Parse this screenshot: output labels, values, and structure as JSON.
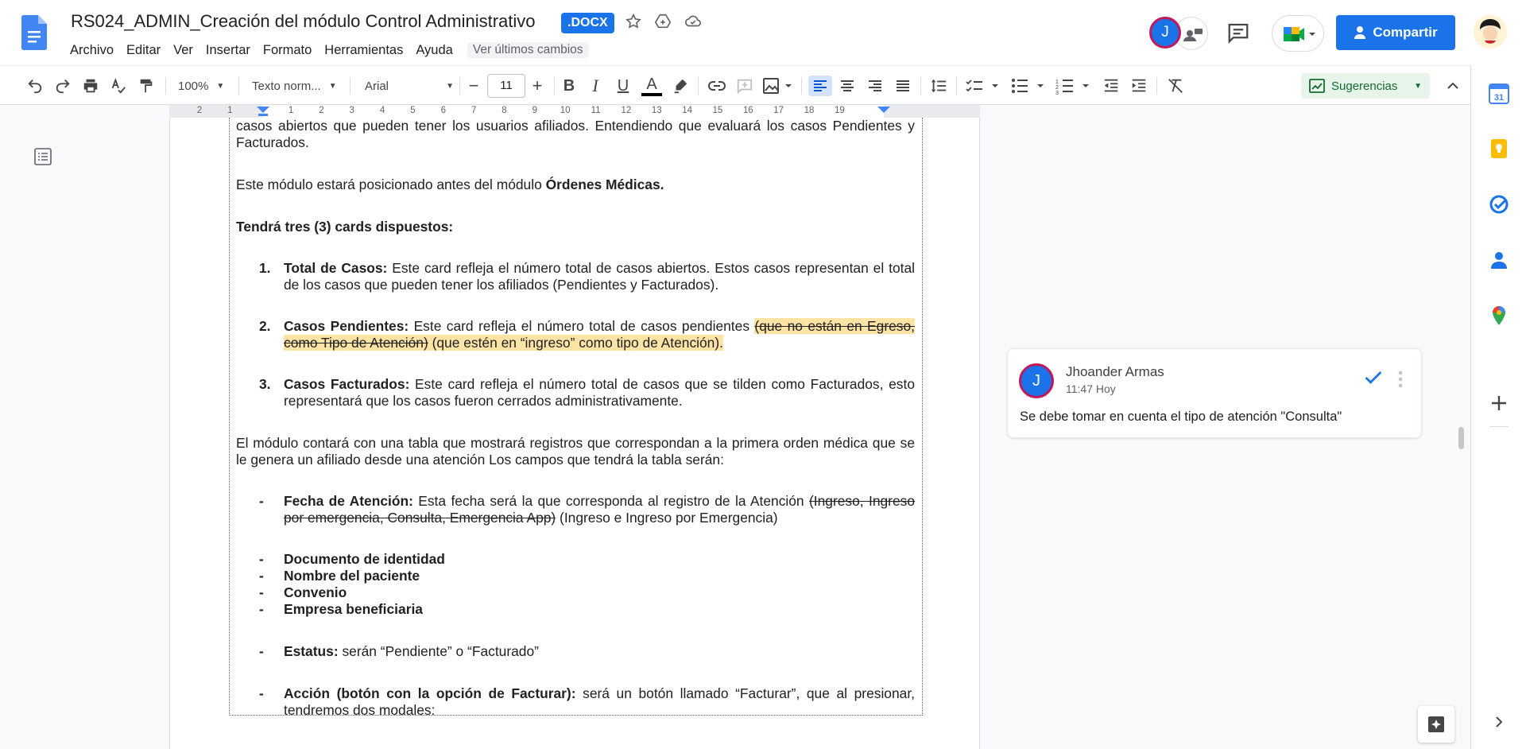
{
  "document": {
    "title": "RS024_ADMIN_Creación del módulo Control Administrativo",
    "format_badge": ".DOCX"
  },
  "menu": [
    "Archivo",
    "Editar",
    "Ver",
    "Insertar",
    "Formato",
    "Herramientas",
    "Ayuda"
  ],
  "last_edit": "Ver últimos cambios",
  "collaborator_initial": "J",
  "share_label": "Compartir",
  "toolbar": {
    "zoom": "100%",
    "style": "Texto norm...",
    "font": "Arial",
    "font_size": "11",
    "bold": "B",
    "italic": "I",
    "underline": "U",
    "text_color": "A",
    "mode": "Sugerencias"
  },
  "ruler_labels": [
    "2",
    "1",
    "",
    "1",
    "2",
    "3",
    "4",
    "5",
    "6",
    "7",
    "8",
    "9",
    "10",
    "11",
    "12",
    "13",
    "14",
    "15",
    "16",
    "17",
    "18",
    "19"
  ],
  "body": {
    "p0": "casos abiertos que pueden tener los usuarios afiliados. Entendiendo que evaluará los casos Pendientes y Facturados.",
    "p1_text": "Este módulo estará posicionado antes del módulo ",
    "p1_bold": "Órdenes Médicas.",
    "p2_bold": "Tendrá tres (3) cards dispuestos:",
    "item1": {
      "marker": "1.",
      "bold": "Total de Casos:",
      "text": " Este card refleja el número total de casos abiertos. Estos casos representan el total de los casos que pueden tener los afiliados (Pendientes y Facturados)."
    },
    "item2": {
      "marker": "2.",
      "bold": "Casos Pendientes:",
      "text": " Este card refleja el número total de casos pendientes ",
      "deleted": "(que no están en Egreso, como Tipo de Atención)",
      "inserted": " (que estén en “ingreso” como tipo de Atención)."
    },
    "item3": {
      "marker": "3.",
      "bold": "Casos Facturados:",
      "text": " Este card refleja el número total de casos que se tilden como Facturados, esto representará que los casos fueron cerrados administrativamente."
    },
    "p3": "El módulo contará con una tabla que mostrará registros que correspondan a la primera orden médica que se le genera un afiliado desde una atención Los campos que tendrá la  tabla serán:",
    "field1": {
      "marker": "-",
      "bold": "Fecha de Atención:",
      "text": " Esta fecha será la que corresponda al registro de la Atención ",
      "deleted": "(Ingreso, Ingreso por emergencia, Consulta, Emergencia App)",
      "inserted": " (Ingreso e Ingreso por Emergencia)"
    },
    "field2": {
      "marker": "-",
      "bold": "Documento de identidad"
    },
    "field3": {
      "marker": "-",
      "bold": "Nombre del paciente"
    },
    "field4": {
      "marker": "-",
      "bold": "Convenio"
    },
    "field5": {
      "marker": "-",
      "bold": "Empresa beneficiaria"
    },
    "field6": {
      "marker": "-",
      "bold": "Estatus:",
      "text": " serán “Pendiente” o “Facturado”"
    },
    "field7": {
      "marker": "-",
      "bold": "Acción (botón con la opción de Facturar):",
      "text": " será un botón llamado “Facturar”, que al presionar, tendremos dos modales:"
    }
  },
  "comment": {
    "initial": "J",
    "author": "Jhoander Armas",
    "time": "11:47 Hoy",
    "text": "Se debe tomar en cuenta el tipo de atención \"Consulta\""
  },
  "colors": {
    "brand": "#1a73e8",
    "suggestion_highlight": "#fde4a5",
    "suggestion_mode": "#146c2e"
  },
  "icons": [
    "undo-icon",
    "redo-icon",
    "print-icon",
    "spellcheck-icon",
    "paint-format-icon",
    "highlighter-icon",
    "link-icon",
    "add-comment-icon",
    "image-icon",
    "align-left-icon",
    "align-center-icon",
    "align-right-icon",
    "justify-icon",
    "line-spacing-icon",
    "checklist-icon",
    "bullet-list-icon",
    "numbered-list-icon",
    "decrease-indent-icon",
    "increase-indent-icon",
    "clear-format-icon",
    "outline-icon",
    "calendar-icon",
    "keep-icon",
    "tasks-icon",
    "contacts-icon",
    "maps-icon",
    "add-icon"
  ]
}
